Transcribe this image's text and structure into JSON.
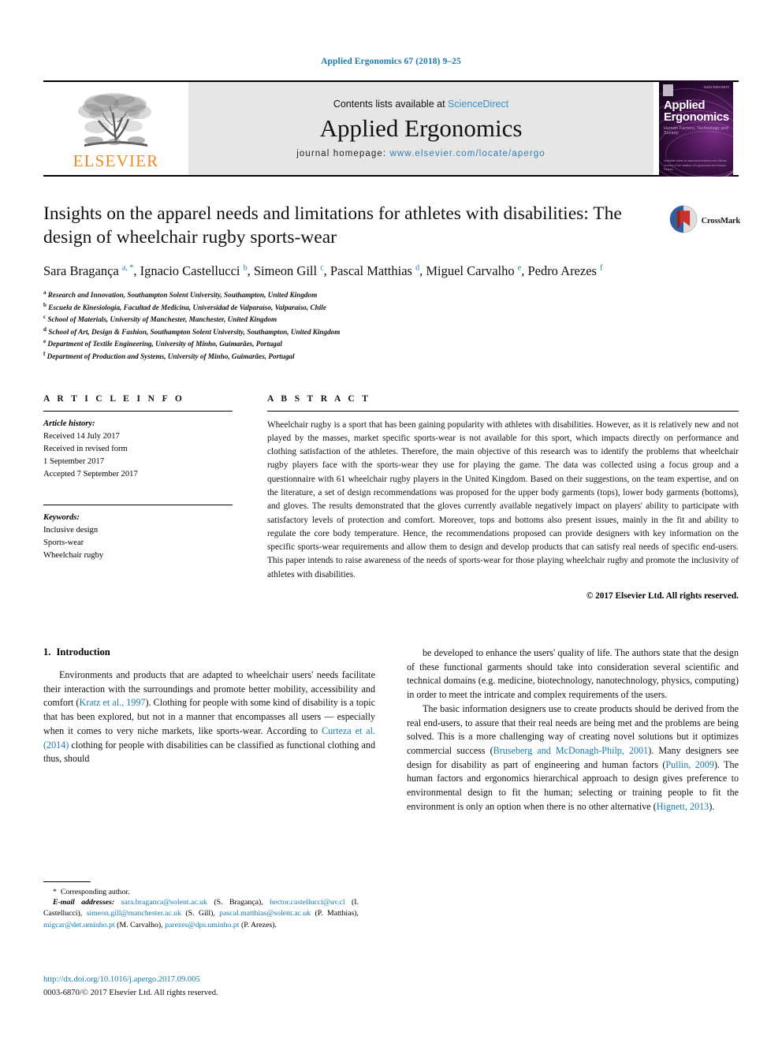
{
  "running_head": "Applied Ergonomics 67 (2018) 9–25",
  "masthead": {
    "publisher_name": "ELSEVIER",
    "publisher_logo_name": "elsevier-tree-logo",
    "contents_prefix": "Contents lists available at",
    "contents_link": "ScienceDirect",
    "journal_name": "Applied Ergonomics",
    "homepage_prefix": "journal homepage:",
    "homepage_url": "www.elsevier.com/locate/apergo",
    "cover": {
      "title_line1": "Applied",
      "title_line2": "Ergonomics",
      "subtitle": "Human Factors, Technology and Society",
      "issue": "ISSN 0003-6870",
      "footer": "Available online at www.sciencedirect.com\nOfficial Journal of the Institute of Ergonomics and Human Factors"
    }
  },
  "article": {
    "title": "Insights on the apparel needs and limitations for athletes with disabilities: The design of wheelchair rugby sports-wear",
    "crossmark_label": "CrossMark",
    "authors_html": "Sara Bragança <sup>a, *</sup>, Ignacio Castellucci <sup>b</sup>, Simeon Gill <sup>c</sup>, Pascal Matthias <sup>d</sup>, Miguel Carvalho <sup>e</sup>, Pedro Arezes <sup>f</sup>",
    "affiliations": [
      {
        "mark": "a",
        "text": "Research and Innovation, Southampton Solent University, Southampton, United Kingdom"
      },
      {
        "mark": "b",
        "text": "Escuela de Kinesiología, Facultad de Medicina, Universidad de Valparaíso, Valparaíso, Chile"
      },
      {
        "mark": "c",
        "text": "School of Materials, University of Manchester, Manchester, United Kingdom"
      },
      {
        "mark": "d",
        "text": "School of Art, Design & Fashion, Southampton Solent University, Southampton, United Kingdom"
      },
      {
        "mark": "e",
        "text": "Department of Textile Engineering, University of Minho, Guimarães, Portugal"
      },
      {
        "mark": "f",
        "text": "Department of Production and Systems, University of Minho, Guimarães, Portugal"
      }
    ]
  },
  "article_info": {
    "heading": "A R T I C L E   I N F O",
    "history_label": "Article history:",
    "history": [
      "Received 14 July 2017",
      "Received in revised form",
      "1 September 2017",
      "Accepted 7 September 2017"
    ],
    "keywords_label": "Keywords:",
    "keywords": [
      "Inclusive design",
      "Sports-wear",
      "Wheelchair rugby"
    ]
  },
  "abstract": {
    "heading": "A B S T R A C T",
    "text": "Wheelchair rugby is a sport that has been gaining popularity with athletes with disabilities. However, as it is relatively new and not played by the masses, market specific sports-wear is not available for this sport, which impacts directly on performance and clothing satisfaction of the athletes. Therefore, the main objective of this research was to identify the problems that wheelchair rugby players face with the sports-wear they use for playing the game. The data was collected using a focus group and a questionnaire with 61 wheelchair rugby players in the United Kingdom. Based on their suggestions, on the team expertise, and on the literature, a set of design recommendations was proposed for the upper body garments (tops), lower body garments (bottoms), and gloves. The results demonstrated that the gloves currently available negatively impact on players' ability to participate with satisfactory levels of protection and comfort. Moreover, tops and bottoms also present issues, mainly in the fit and ability to regulate the core body temperature. Hence, the recommendations proposed can provide designers with key information on the specific sports-wear requirements and allow them to design and develop products that can satisfy real needs of specific end-users. This paper intends to raise awareness of the needs of sports-wear for those playing wheelchair rugby and promote the inclusivity of athletes with disabilities.",
    "copyright": "© 2017 Elsevier Ltd. All rights reserved."
  },
  "introduction": {
    "number": "1.",
    "heading": "Introduction",
    "left_paragraph_html": "Environments and products that are adapted to wheelchair users' needs facilitate their interaction with the surroundings and promote better mobility, accessibility and comfort (<span class=\"ref\">Kratz et al., 1997</span>). Clothing for people with some kind of disability is a topic that has been explored, but not in a manner that encompasses all users &mdash; especially when it comes to very niche markets, like sports-wear. According to <span class=\"ref\">Curteza et al. (2014)</span> clothing for people with disabilities can be classified as functional clothing and thus, should",
    "right_paragraph_1_html": "be developed to enhance the users' quality of life. The authors state that the design of these functional garments should take into consideration several scientific and technical domains (e.g. medicine, biotechnology, nanotechnology, physics, computing) in order to meet the intricate and complex requirements of the users.",
    "right_paragraph_2_html": "The basic information designers use to create products should be derived from the real end-users, to assure that their real needs are being met and the problems are being solved. This is a more challenging way of creating novel solutions but it optimizes commercial success (<span class=\"ref\">Bruseberg and McDonagh-Philp, 2001</span>). Many designers see design for disability as part of engineering and human factors (<span class=\"ref\">Pullin, 2009</span>). The human factors and ergonomics hierarchical approach to design gives preference to environmental design to fit the human; selecting or training people to fit the environment is only an option when there is no other alternative (<span class=\"ref\">Hignett, 2013</span>)."
  },
  "footer": {
    "corresponding_author": "Corresponding author.",
    "email_label": "E-mail addresses:",
    "emails_html": "<span class=\"mail\">sara.braganca@solent.ac.uk</span> (S. Bragança), <span class=\"mail\">hector.castellucci@uv.cl</span> (I. Castellucci), <span class=\"mail\">simeon.gill@manchester.ac.uk</span> (S. Gill), <span class=\"mail\">pascal.matthias@solent.ac.uk</span> (P. Matthias), <span class=\"mail\">migcar@det.uminho.pt</span> (M. Carvalho), <span class=\"mail\">parezes@dps.uminho.pt</span> (P. Arezes).",
    "doi": "http://dx.doi.org/10.1016/j.apergo.2017.09.005",
    "issn_line": "0003-6870/© 2017 Elsevier Ltd. All rights reserved."
  },
  "colors": {
    "link_blue": "#1a7aab",
    "elsevier_orange": "#f08a22",
    "masthead_gray": "#e6e6e6"
  }
}
